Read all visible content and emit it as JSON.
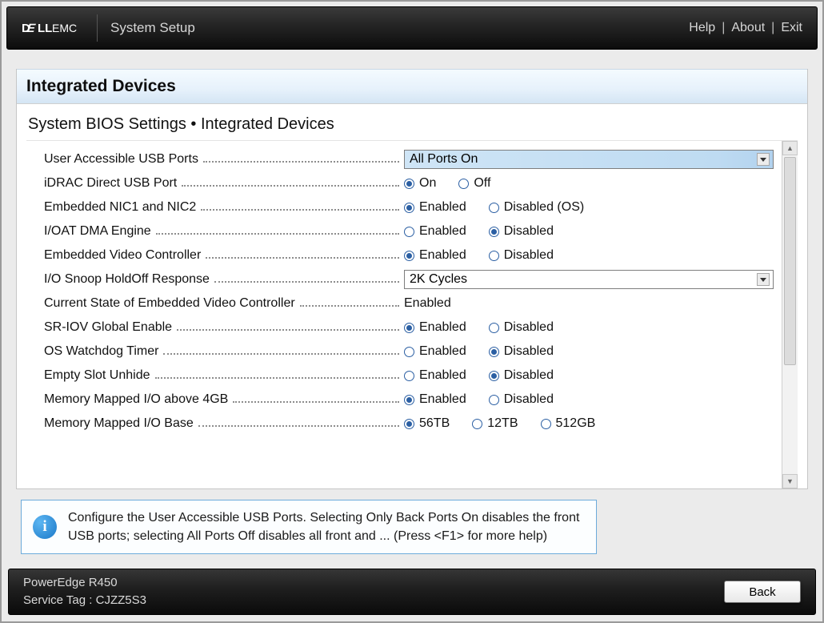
{
  "brand": "DELL EMC",
  "app_title": "System Setup",
  "top_links": {
    "help": "Help",
    "about": "About",
    "exit": "Exit"
  },
  "page_title": "Integrated Devices",
  "breadcrumb": "System BIOS Settings • Integrated Devices",
  "rows": {
    "usb_ports": {
      "label": "User Accessible USB Ports",
      "value": "All Ports On"
    },
    "idrac_usb": {
      "label": "iDRAC Direct USB Port",
      "opt1": "On",
      "opt2": "Off",
      "selected": 1
    },
    "embedded_nic": {
      "label": "Embedded NIC1 and NIC2",
      "opt1": "Enabled",
      "opt2": "Disabled (OS)",
      "selected": 1
    },
    "ioat": {
      "label": "I/OAT DMA Engine",
      "opt1": "Enabled",
      "opt2": "Disabled",
      "selected": 2
    },
    "video_ctrl": {
      "label": "Embedded Video Controller",
      "opt1": "Enabled",
      "opt2": "Disabled",
      "selected": 1
    },
    "io_snoop": {
      "label": "I/O Snoop HoldOff Response",
      "value": "2K Cycles"
    },
    "video_state": {
      "label": "Current State of Embedded Video Controller",
      "value": "Enabled"
    },
    "sriov": {
      "label": "SR-IOV Global Enable",
      "opt1": "Enabled",
      "opt2": "Disabled",
      "selected": 1
    },
    "watchdog": {
      "label": "OS Watchdog Timer",
      "opt1": "Enabled",
      "opt2": "Disabled",
      "selected": 2
    },
    "empty_slot": {
      "label": "Empty Slot Unhide",
      "opt1": "Enabled",
      "opt2": "Disabled",
      "selected": 2
    },
    "mmio4gb": {
      "label": "Memory Mapped I/O above 4GB",
      "opt1": "Enabled",
      "opt2": "Disabled",
      "selected": 1
    },
    "mmio_base": {
      "label": "Memory Mapped I/O Base",
      "opt1": "56TB",
      "opt2": "12TB",
      "opt3": "512GB",
      "selected": 1
    }
  },
  "help_text": "Configure the User Accessible USB Ports. Selecting Only Back Ports On disables the front USB ports; selecting All Ports Off disables all front and ... (Press <F1> for more help)",
  "footer": {
    "model": "PowerEdge R450",
    "service_tag_label": "Service Tag :",
    "service_tag": "CJZZ5S3",
    "back": "Back"
  }
}
